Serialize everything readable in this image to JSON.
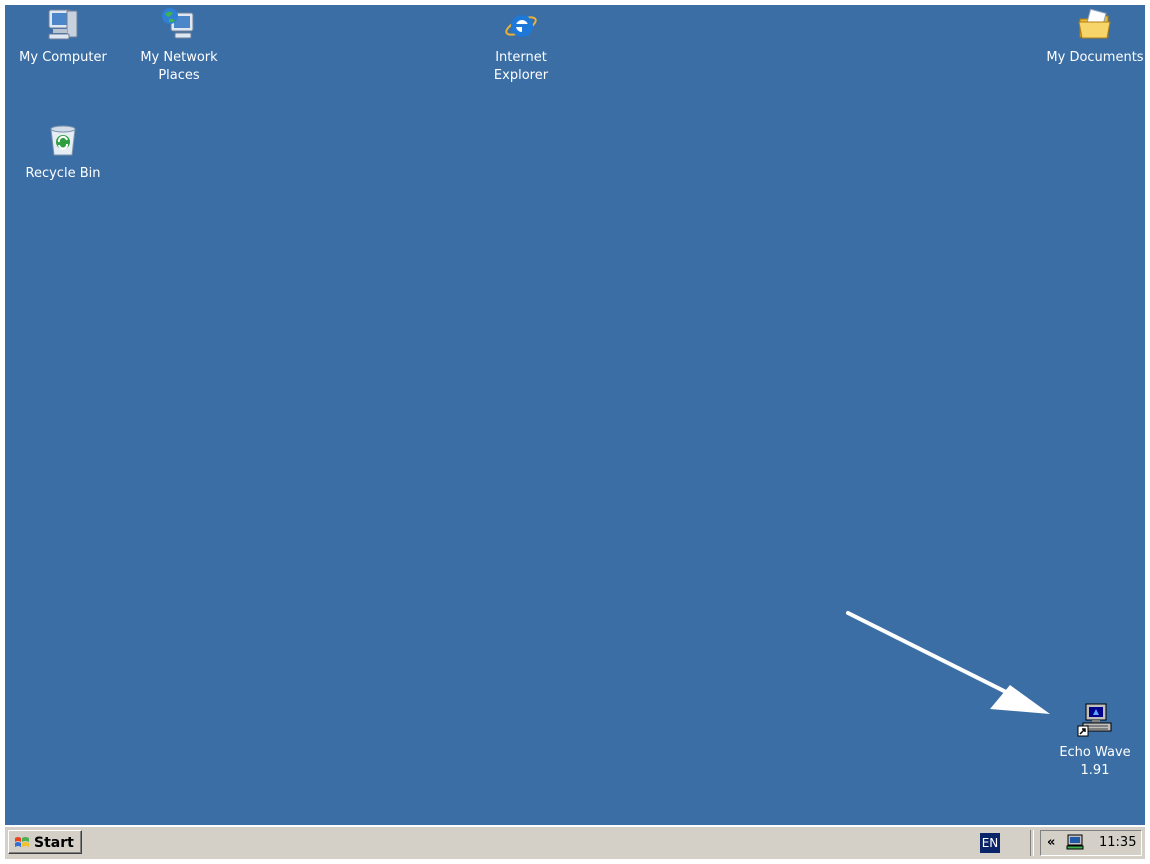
{
  "desktop": {
    "background_color": "#3a6ea5",
    "icons": {
      "my_computer": {
        "label": "My Computer",
        "icon": "my-computer-icon"
      },
      "my_network_places": {
        "label": "My Network\nPlaces",
        "icon": "network-places-icon"
      },
      "internet_explorer": {
        "label": "Internet\nExplorer",
        "icon": "internet-explorer-icon"
      },
      "my_documents": {
        "label": "My Documents",
        "icon": "folder-documents-icon"
      },
      "recycle_bin": {
        "label": "Recycle Bin",
        "icon": "recycle-bin-icon"
      },
      "echo_wave": {
        "label": "Echo Wave\n1.91",
        "icon": "echo-wave-shortcut-icon"
      }
    },
    "annotation": {
      "icon": "arrow-pointer-icon",
      "color": "#ffffff"
    }
  },
  "taskbar": {
    "start_label": "Start",
    "language": "EN",
    "tray_expand": "«",
    "clock": "11:35"
  }
}
